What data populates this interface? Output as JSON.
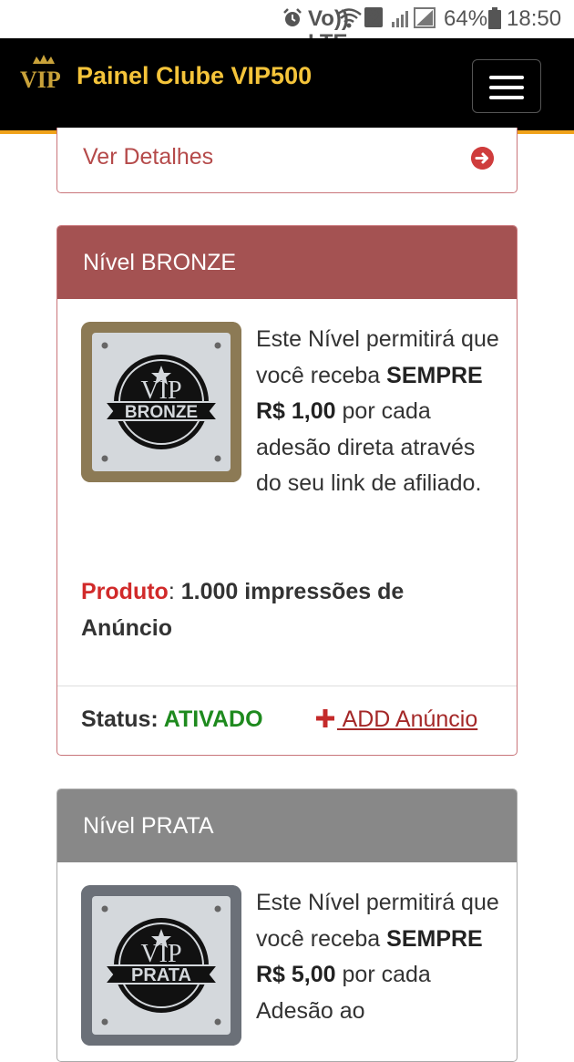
{
  "status_bar": {
    "volte": "Vo)) LTE",
    "sim": "2",
    "battery": "64%",
    "time": "18:50"
  },
  "navbar": {
    "logo_text": "VIP",
    "title": "Painel Clube VIP500"
  },
  "top_card": {
    "link_label": "Ver Detalhes"
  },
  "levels": [
    {
      "header": "Nível BRONZE",
      "badge_top": "VIP",
      "badge_name": "BRONZE",
      "desc_1": "Este Nível permitirá que você receba ",
      "desc_bold": "SEMPRE R$ 1,00",
      "desc_2": " por cada adesão direta através do seu link de afiliado.",
      "product_label": "Produto",
      "product_value": "1.000 impressões de Anúncio",
      "status_label": "Status: ",
      "status_value": "ATIVADO",
      "add_label": " ADD Anúncio"
    },
    {
      "header": "Nível PRATA",
      "badge_top": "VIP",
      "badge_name": "PRATA",
      "desc_1": "Este Nível permitirá que você receba ",
      "desc_bold": "SEMPRE R$ 5,00",
      "desc_2": " por cada Adesão ao"
    }
  ],
  "colors": {
    "navbar_bg": "#000000",
    "brand_gold": "#f5c43a",
    "bronze_header": "#a45252",
    "prata_header": "#888888",
    "status_green": "#1e8a1e",
    "product_red": "#d12a2a"
  }
}
